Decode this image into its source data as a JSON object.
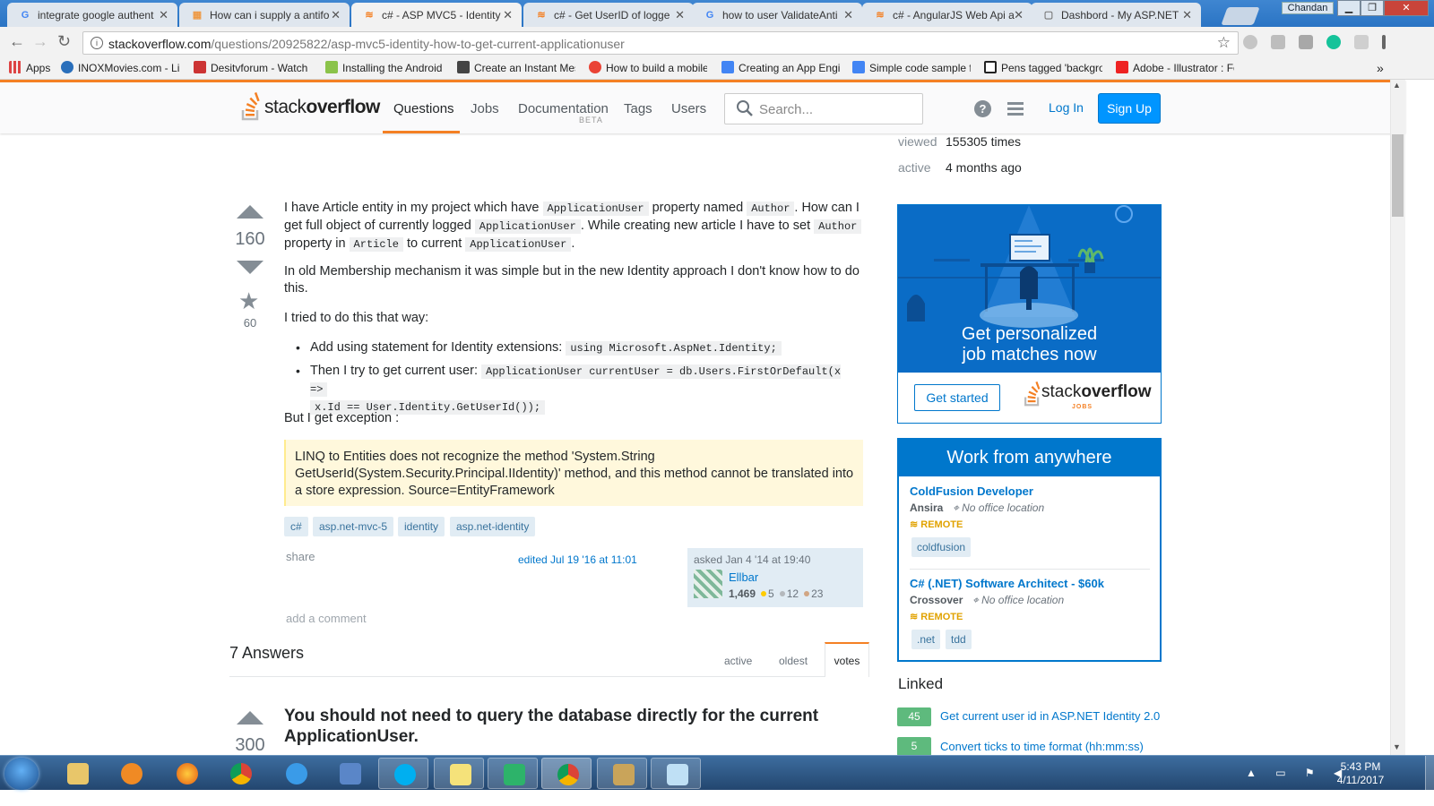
{
  "browser": {
    "tabs": [
      {
        "label": "integrate google authent",
        "favicon": "G",
        "active": false
      },
      {
        "label": "How can i supply a antifo",
        "favicon": "▦",
        "active": false
      },
      {
        "label": "c# - ASP MVC5 - Identity",
        "favicon": "≋",
        "active": true
      },
      {
        "label": "c# - Get UserID of logge",
        "favicon": "≋",
        "active": false
      },
      {
        "label": "how to user ValidateAnti",
        "favicon": "G",
        "active": false
      },
      {
        "label": "c# - AngularJS Web Api a",
        "favicon": "≋",
        "active": false
      },
      {
        "label": "Dashbord - My ASP.NET",
        "favicon": "▢",
        "active": false
      }
    ],
    "close_glyph": "✕",
    "user_button": "Chandan",
    "window_buttons": {
      "minimize": "▁",
      "maximize": "❐",
      "close": "✕"
    },
    "nav": {
      "back": "←",
      "forward": "→",
      "reload": "↻"
    },
    "url_host": "stackoverflow.com",
    "url_path": "/questions/20925822/asp-mvc5-identity-how-to-get-current-applicationuser",
    "info_glyph": "i",
    "star_glyph": "☆",
    "bookmarks": [
      {
        "label": "Apps",
        "color": "#d44"
      },
      {
        "label": "INOXMovies.com - Liv",
        "color": "#2a6fbb"
      },
      {
        "label": "Desitvforum - Watch",
        "color": "#c33"
      },
      {
        "label": "Installing the Android",
        "color": "#8bc34a"
      },
      {
        "label": "Create an Instant Mes",
        "color": "#444"
      },
      {
        "label": "How to build a mobile",
        "color": "#ea4335"
      },
      {
        "label": "Creating an App Engi",
        "color": "#4285f4"
      },
      {
        "label": "Simple code sample fo",
        "color": "#4285f4"
      },
      {
        "label": "Pens tagged 'backgro",
        "color": "#222"
      },
      {
        "label": "Adobe - Illustrator : Fo",
        "color": "#e22"
      }
    ],
    "bookmarks_more": "»"
  },
  "so": {
    "logo_pre": "stack",
    "logo_bold": "overflow",
    "nav": {
      "questions": "Questions",
      "jobs": "Jobs",
      "documentation": "Documentation",
      "beta": "BETA",
      "tags": "Tags",
      "users": "Users"
    },
    "search_placeholder": "Search...",
    "help_glyph": "?",
    "login": "Log In",
    "signup": "Sign Up"
  },
  "question": {
    "votes": "160",
    "favorites": "60",
    "para1": {
      "t1": "I have Article entity in my project which have ",
      "c1": "ApplicationUser",
      "t2": " property named ",
      "c2": "Author",
      "t3": ". How can I get full object of currently logged ",
      "c3": "ApplicationUser",
      "t4": ". While creating new article I have to set ",
      "c4": "Author",
      "t5": " property in ",
      "c5": "Article",
      "t6": " to current ",
      "c6": "ApplicationUser",
      "t7": "."
    },
    "para2": "In old Membership mechanism it was simple but in the new Identity approach I don't know how to do this.",
    "para3": "I tried to do this that way:",
    "bullet1_text": "Add using statement for Identity extensions: ",
    "bullet1_code": "using Microsoft.AspNet.Identity;",
    "bullet2_text": "Then I try to get current user: ",
    "bullet2_code_a": "ApplicationUser currentUser = db.Users.FirstOrDefault(x =>",
    "bullet2_code_b": "x.Id == User.Identity.GetUserId());",
    "para4": "But I get exception :",
    "exception": "LINQ to Entities does not recognize the method 'System.String GetUserId(System.Security.Principal.IIdentity)' method, and this method cannot be translated into a store expression. Source=EntityFramework",
    "tags": [
      "c#",
      "asp.net-mvc-5",
      "identity",
      "asp.net-identity"
    ],
    "share": "share",
    "edited": "edited Jul 19 '16 at 11:01",
    "asked": "asked Jan 4 '14 at 19:40",
    "user": {
      "name": "Ellbar",
      "rep": "1,469",
      "gold": "5",
      "silver": "12",
      "bronze": "23"
    },
    "add_comment": "add a comment"
  },
  "answers": {
    "heading": "7 Answers",
    "sort": {
      "active": "active",
      "oldest": "oldest",
      "votes": "votes"
    },
    "first": {
      "votes": "300",
      "title": "You should not need to query the database directly for the current ApplicationUser."
    }
  },
  "sidebar": {
    "viewed_label": "viewed",
    "viewed_value": "155305 times",
    "active_label": "active",
    "active_value": "4 months ago",
    "ad1": {
      "headline1": "Get personalized",
      "headline2": "job matches now",
      "button": "Get started",
      "logo_pre": "stack",
      "logo_bold": "overflow",
      "logo_sub": "JOBS"
    },
    "ad2": {
      "heading": "Work from anywhere",
      "jobs": [
        {
          "title": "ColdFusion Developer",
          "company": "Ansira",
          "location": "No office location",
          "remote": "REMOTE",
          "tags": [
            "coldfusion"
          ]
        },
        {
          "title": "C# (.NET) Software Architect - $60k",
          "company": "Crossover",
          "location": "No office location",
          "remote": "REMOTE",
          "tags": [
            ".net",
            "tdd"
          ]
        }
      ]
    },
    "linked_heading": "Linked",
    "linked": [
      {
        "count": "45",
        "title": "Get current user id in ASP.NET Identity 2.0"
      },
      {
        "count": "5",
        "title": "Convert ticks to time format (hh:mm:ss)"
      }
    ]
  },
  "taskbar": {
    "apps": [
      "explorer",
      "media-player",
      "firefox",
      "chrome",
      "internet-explorer",
      "remote-desktop",
      "skype",
      "sticky-notes",
      "visual-studio",
      "chrome-active",
      "snipping-tool",
      "notepad"
    ],
    "tray_glyphs": "▲ ▭ ⚑ ◀",
    "time": "5:43 PM",
    "date": "4/11/2017"
  }
}
